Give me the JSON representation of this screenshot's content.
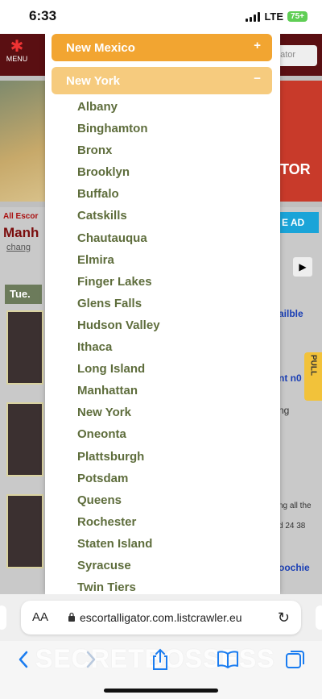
{
  "status_bar": {
    "time": "6:33",
    "network": "LTE",
    "battery": "75+"
  },
  "background_page": {
    "menu_label": "MENU",
    "search_placeholder": "gator",
    "logo_text": "TOR",
    "location_label": "All Escor",
    "city": "Manh",
    "change_link": "chang",
    "day": "Tue.",
    "ad_button": "E AD",
    "right_texts": [
      "ailble",
      "nt n0",
      "ng",
      "ng all the",
      "d 24 38",
      "oochie"
    ],
    "pull_tab": "PULL"
  },
  "modal": {
    "states": [
      {
        "name": "New Mexico",
        "sign": "+",
        "color": "#f2a531"
      },
      {
        "name": "New York",
        "sign": "−",
        "color": "#f6cb7e"
      }
    ],
    "cities": [
      "Albany",
      "Binghamton",
      "Bronx",
      "Brooklyn",
      "Buffalo",
      "Catskills",
      "Chautauqua",
      "Elmira",
      "Finger Lakes",
      "Glens Falls",
      "Hudson Valley",
      "Ithaca",
      "Long Island",
      "Manhattan",
      "New York",
      "Oneonta",
      "Plattsburgh",
      "Potsdam",
      "Queens",
      "Rochester",
      "Staten Island",
      "Syracuse",
      "Twin Tiers"
    ],
    "city_color": "#5e6d3c"
  },
  "browser": {
    "aa_label": "AA",
    "url": "escortalligator.com.listcrawler.eu",
    "watermark": "SECRETBOSSESS"
  },
  "colors": {
    "accent": "#1a7cf0",
    "header_bg": "#5a0f12"
  }
}
